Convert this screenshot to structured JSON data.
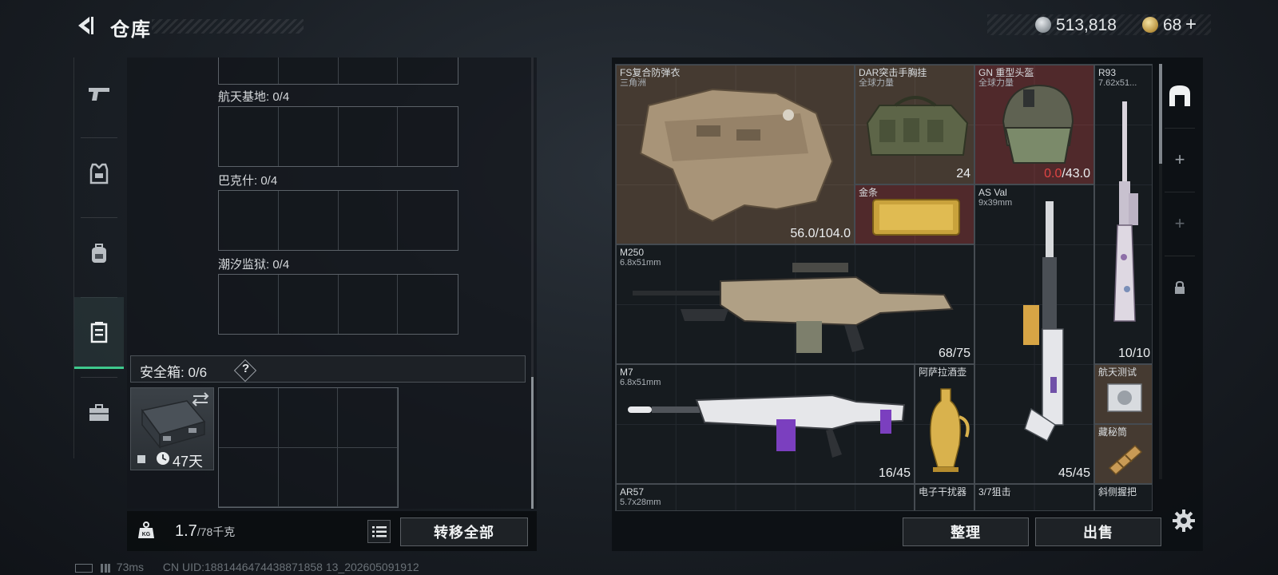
{
  "header": {
    "title": "仓库",
    "currency_silver": "513,818",
    "currency_gold": "68",
    "currency_gold_plus": "+"
  },
  "left_nav": {
    "items": [
      {
        "name": "weapons",
        "icon": "gun-icon"
      },
      {
        "name": "armor",
        "icon": "vest-icon"
      },
      {
        "name": "backpack",
        "icon": "backpack-icon"
      },
      {
        "name": "storage",
        "icon": "container-icon",
        "active": true
      },
      {
        "name": "toolbox",
        "icon": "briefcase-icon"
      }
    ]
  },
  "zones": [
    {
      "label": "航天基地: 0/4"
    },
    {
      "label": "巴克什: 0/4"
    },
    {
      "label": "潮汐监狱: 0/4"
    }
  ],
  "safe_box": {
    "title": "安全箱: 0/6",
    "help": "?",
    "days": "47天"
  },
  "left_bottom": {
    "weight_value": "1.7",
    "weight_max": "/78千克",
    "transfer_label": "转移全部"
  },
  "items": [
    {
      "name": "FS复合防弹衣",
      "sub": "三角洲",
      "dur": "56.0/104.0"
    },
    {
      "name": "DAR突击手胸挂",
      "sub": "全球力量",
      "dur": "24"
    },
    {
      "name": "GN 重型头盔",
      "sub": "全球力量",
      "dur_red": "0.0",
      "dur_rest": "/43.0"
    },
    {
      "name": "R93",
      "sub": "7.62x51...",
      "dur": "10/10"
    },
    {
      "name": "金条",
      "sub": "",
      "dur": ""
    },
    {
      "name": "AS Val",
      "sub": "9x39mm",
      "dur": "45/45"
    },
    {
      "name": "M250",
      "sub": "6.8x51mm",
      "dur": "68/75"
    },
    {
      "name": "M7",
      "sub": "6.8x51mm",
      "dur": "16/45"
    },
    {
      "name": "阿萨拉酒壶",
      "sub": "",
      "dur": ""
    },
    {
      "name": "航天测试",
      "sub": "",
      "dur": ""
    },
    {
      "name": "藏秘筒",
      "sub": "",
      "dur": ""
    },
    {
      "name": "AR57",
      "sub": "5.7x28mm",
      "dur": ""
    },
    {
      "name": "电子干扰器",
      "sub": "",
      "dur": ""
    },
    {
      "name": "3/7狙击",
      "sub": "",
      "dur": ""
    },
    {
      "name": "斜侧握把",
      "sub": "",
      "dur": ""
    }
  ],
  "right_bottom": {
    "sort_label": "整理",
    "sell_label": "出售"
  },
  "status": {
    "ping": "73ms",
    "uid": "CN UID:1881446474438871858 13_202605091912"
  },
  "colors": {
    "accent_green": "#3ec98d",
    "durability_red": "#e04444"
  }
}
